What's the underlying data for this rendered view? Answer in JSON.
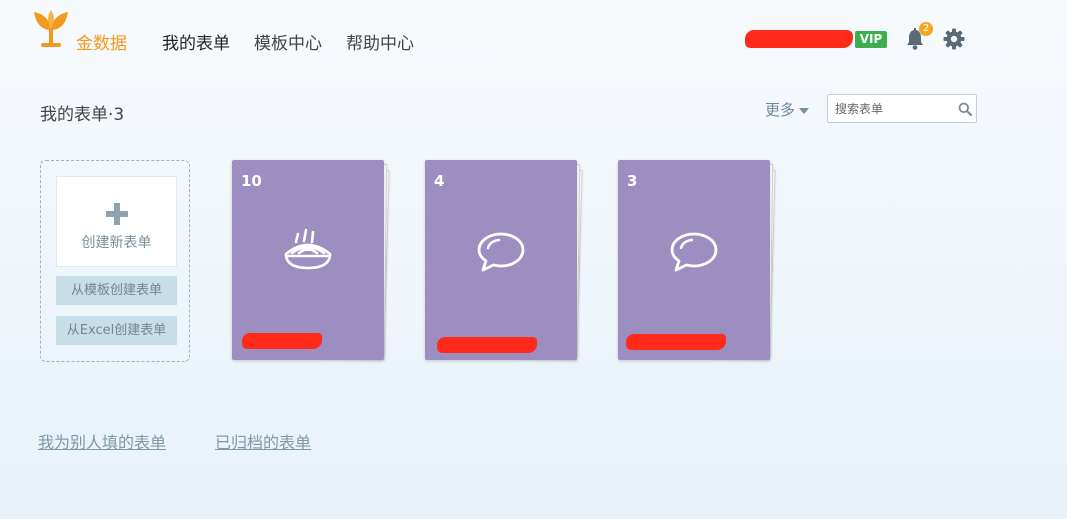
{
  "brand": {
    "name": "金数据",
    "color": "#f39a1e"
  },
  "nav": {
    "items": [
      {
        "label": "我的表单",
        "active": true
      },
      {
        "label": "模板中心",
        "active": false
      },
      {
        "label": "帮助中心",
        "active": false
      }
    ]
  },
  "user": {
    "vip_label": "VIP",
    "notification_count": "2"
  },
  "section": {
    "title": "我的表单·3",
    "more_label": "更多",
    "search_placeholder": "搜索表单"
  },
  "create": {
    "new_label": "创建新表单",
    "from_template_label": "从模板创建表单",
    "from_excel_label": "从Excel创建表单"
  },
  "forms": [
    {
      "count": "10",
      "icon": "noodle-bowl-icon",
      "color": "#9b8cbf"
    },
    {
      "count": "4",
      "icon": "speech-bubble-icon",
      "color": "#9b8cbf"
    },
    {
      "count": "3",
      "icon": "speech-bubble-icon",
      "color": "#9b8cbf"
    }
  ],
  "footer_links": {
    "filled_for_others": "我为别人填的表单",
    "archived": "已归档的表单"
  }
}
